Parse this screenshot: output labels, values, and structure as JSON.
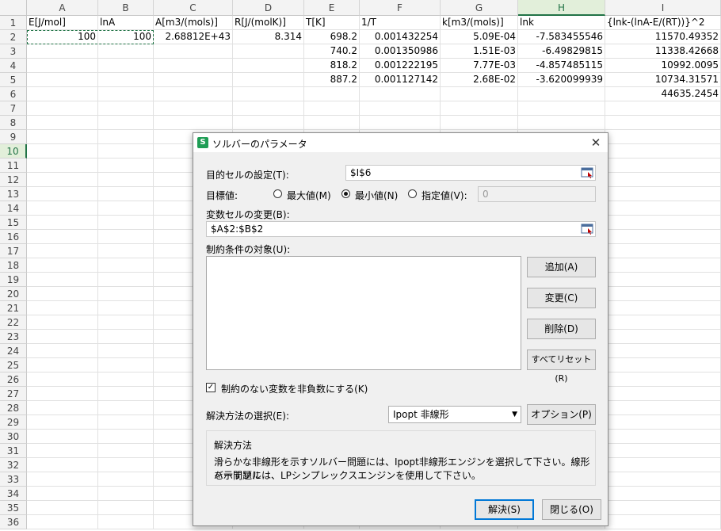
{
  "columns": [
    "A",
    "B",
    "C",
    "D",
    "E",
    "F",
    "G",
    "H",
    "I"
  ],
  "selected_column": "H",
  "selected_row": "10",
  "rows": [
    "1",
    "2",
    "3",
    "4",
    "5",
    "6",
    "7",
    "8",
    "9",
    "10",
    "11",
    "12",
    "13",
    "14",
    "15",
    "16",
    "17",
    "18",
    "19",
    "20",
    "21",
    "22",
    "23",
    "24",
    "25",
    "26",
    "27",
    "28",
    "29",
    "30",
    "31",
    "32",
    "33",
    "34",
    "35",
    "36"
  ],
  "cells": {
    "r1": [
      "E[J/mol]",
      "lnA",
      "A[m3/(mols)]",
      "R[J/(molK)]",
      "T[K]",
      "1/T",
      "k[m3/(mols)]",
      "lnk",
      "{lnk-(lnA-E/(RT))}^2"
    ],
    "r2": [
      "100",
      "100",
      "2.68812E+43",
      "8.314",
      "698.2",
      "0.001432254",
      "5.09E-04",
      "-7.583455546",
      "11570.49352"
    ],
    "r3": [
      "",
      "",
      "",
      "",
      "740.2",
      "0.001350986",
      "1.51E-03",
      "-6.49829815",
      "11338.42668"
    ],
    "r4": [
      "",
      "",
      "",
      "",
      "818.2",
      "0.001222195",
      "7.77E-03",
      "-4.857485115",
      "10992.0095"
    ],
    "r5": [
      "",
      "",
      "",
      "",
      "887.2",
      "0.001127142",
      "2.68E-02",
      "-3.620099939",
      "10734.31571"
    ],
    "r6": [
      "",
      "",
      "",
      "",
      "",
      "",
      "",
      "",
      "44635.2454"
    ]
  },
  "dialog": {
    "title": "ソルバーのパラメータ",
    "close_glyph": "✕",
    "icon_letter": "S",
    "objective_label": "目的セルの設定(T):",
    "objective_value": "$I$6",
    "target_label": "目標値:",
    "opt_max": "最大値(M)",
    "opt_min": "最小値(N)",
    "opt_value": "指定値(V):",
    "opt_value_input": "0",
    "variable_label": "変数セルの変更(B):",
    "variable_value": "$A$2:$B$2",
    "constraints_label": "制約条件の対象(U):",
    "btn_add": "追加(A)",
    "btn_change": "変更(C)",
    "btn_delete": "削除(D)",
    "btn_reset": "すべてリセット(R)",
    "nonneg_label": "制約のない変数を非負数にする(K)",
    "method_label": "解決方法の選択(E):",
    "method_value": "Ipopt 非線形",
    "btn_options": "オプション(P)",
    "group_title": "解決方法",
    "desc_line1": "滑らかな非線形を示すソルバー問題には、Ipopt非線形エンジンを選択して下さい。線形を示すソル",
    "desc_line2": "バー問題には、LPシンプレックスエンジンを使用して下さい。",
    "btn_solve": "解決(S)",
    "btn_close": "閉じる(O)"
  }
}
